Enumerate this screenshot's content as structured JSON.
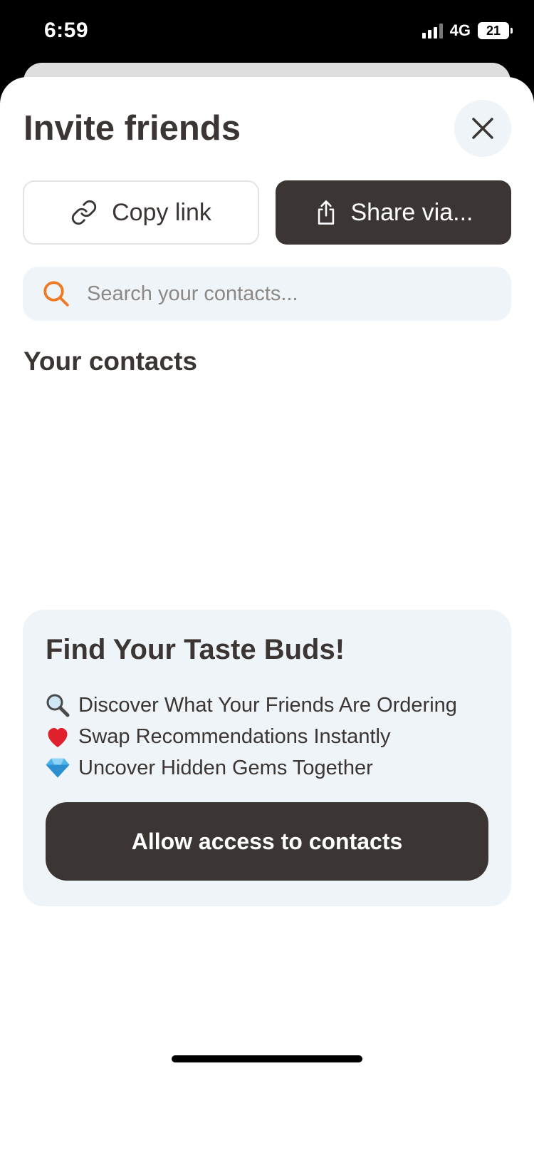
{
  "status_bar": {
    "time": "6:59",
    "network": "4G",
    "battery": "21"
  },
  "sheet": {
    "title": "Invite friends",
    "copy_link_label": "Copy link",
    "share_label": "Share via...",
    "search_placeholder": "Search your contacts...",
    "contacts_heading": "Your contacts"
  },
  "promo": {
    "title": "Find Your Taste Buds!",
    "items": [
      {
        "icon": "magnifier-emoji",
        "text": "Discover What Your Friends Are Ordering"
      },
      {
        "icon": "heart-emoji",
        "text": "Swap Recommendations Instantly"
      },
      {
        "icon": "gem-emoji",
        "text": "Uncover Hidden Gems Together"
      }
    ],
    "button_label": "Allow access to contacts"
  },
  "colors": {
    "primary_dark": "#3b3533",
    "surface_light": "#eef4f7",
    "search_icon": "#ef7a25"
  }
}
